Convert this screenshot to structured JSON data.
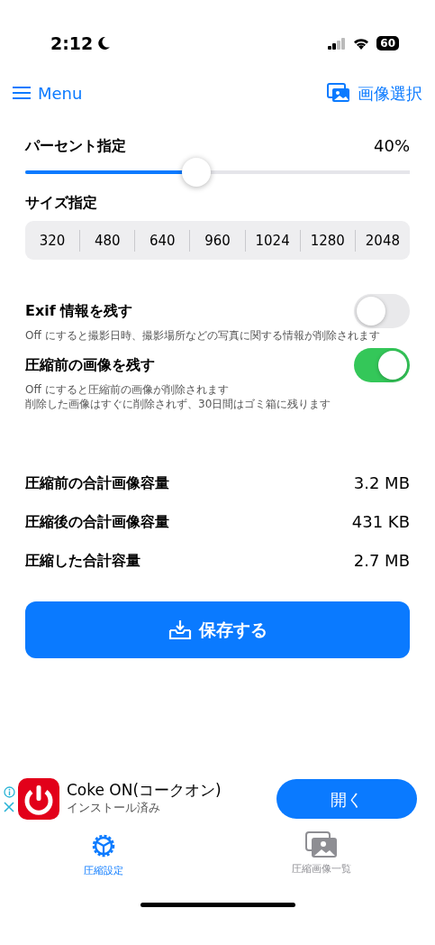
{
  "status_bar": {
    "time": "2:12",
    "battery": "60"
  },
  "nav": {
    "menu": "Menu",
    "select": "画像選択"
  },
  "percent": {
    "label": "パーセント指定",
    "value": "40%",
    "level": 0.445
  },
  "size": {
    "label": "サイズ指定",
    "options": [
      "320",
      "480",
      "640",
      "960",
      "1024",
      "1280",
      "2048"
    ]
  },
  "toggles": [
    {
      "label": "Exif 情報を残す",
      "on": false,
      "notes": [
        "Off にすると撮影日時、撮影場所などの写真に関する情報が削除されます"
      ]
    },
    {
      "label": "圧縮前の画像を残す",
      "on": true,
      "notes": [
        "Off にすると圧縮前の画像が削除されます",
        "削除した画像はすぐに削除されず、30日間はゴミ箱に残ります"
      ]
    }
  ],
  "stats": [
    {
      "label": "圧縮前の合計画像容量",
      "value": "3.2 MB"
    },
    {
      "label": "圧縮後の合計画像容量",
      "value": "431 KB"
    },
    {
      "label": "圧縮した合計容量",
      "value": "2.7 MB"
    }
  ],
  "save_button": "保存する",
  "ad": {
    "title": "Coke ON(コークオン)",
    "subtitle": "インストール済み",
    "button": "開く"
  },
  "tabs": [
    {
      "label": "圧縮設定",
      "selected": true
    },
    {
      "label": "圧縮画像一覧",
      "selected": false
    }
  ]
}
